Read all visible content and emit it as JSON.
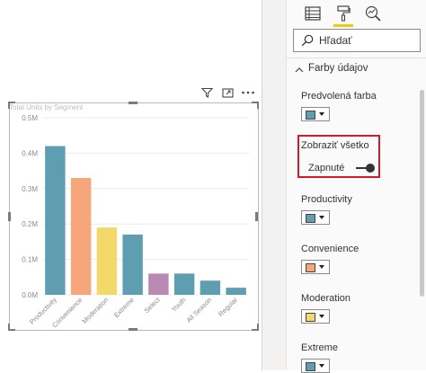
{
  "visual_header": {
    "icons": [
      "filter-icon",
      "focus-mode-icon",
      "more-options-icon"
    ]
  },
  "chart_data": {
    "type": "bar",
    "title": "Total Units by Segment",
    "categories": [
      "Productivity",
      "Convenience",
      "Moderation",
      "Extreme",
      "Select",
      "Youth",
      "All Season",
      "Regular"
    ],
    "values": [
      0.42,
      0.33,
      0.19,
      0.17,
      0.06,
      0.06,
      0.04,
      0.02
    ],
    "bar_colors": [
      "#5f9eb0",
      "#f7a57a",
      "#f2d96a",
      "#5f9eb0",
      "#b889b3",
      "#5f9eb0",
      "#5f9eb0",
      "#5f9eb0"
    ],
    "yticks": [
      "0.0M",
      "0.1M",
      "0.2M",
      "0.3M",
      "0.4M",
      "0.5M"
    ],
    "ylim": [
      0,
      0.5
    ],
    "grid": true,
    "xlabel": "",
    "ylabel": ""
  },
  "pane": {
    "tabs": [
      "fields-icon",
      "format-paint-roller-icon",
      "analytics-magnifier-icon"
    ],
    "search_placeholder": "Hľadať",
    "section_title": "Farby údajov",
    "default_color_label": "Predvolená farba",
    "show_all_label": "Zobraziť všetko",
    "toggle_state": "Zapnuté",
    "items": [
      {
        "label": "Productivity",
        "color": "#5f9eb0"
      },
      {
        "label": "Convenience",
        "color": "#f7a57a"
      },
      {
        "label": "Moderation",
        "color": "#f2d96a"
      },
      {
        "label": "Extreme",
        "color": "#5f9eb0"
      }
    ],
    "default_color": "#5f9eb0",
    "accent": "#f2c811",
    "highlight_color": "#d11a2a"
  }
}
